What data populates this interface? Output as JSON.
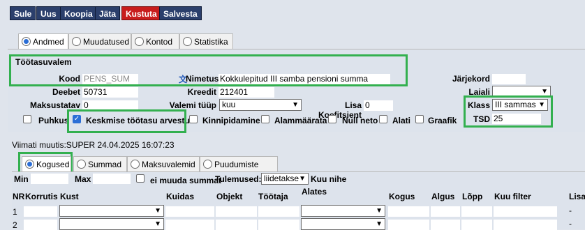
{
  "toolbar": {
    "buttons": [
      "Sule",
      "Uus",
      "Koopia",
      "Jäta",
      "Kustuta",
      "Salvesta"
    ]
  },
  "tabs": [
    "Andmed",
    "Muudatused",
    "Kontod",
    "Statistika"
  ],
  "section_title": "Töötasuvalem",
  "form": {
    "kood_label": "Kood",
    "kood_value": "PENS_SUM",
    "nimetus_label": "Nimetus",
    "nimetus_value": "Kokkulepitud III samba pensioni summa",
    "jarjekord_label": "Järjekord",
    "deebet_label": "Deebet",
    "deebet_value": "50731",
    "kreedit_label": "Kreedit",
    "kreedit_value": "212401",
    "laiali_label": "Laiali",
    "maksustatav_label": "Maksustatav",
    "maksustatav_value": "0",
    "valemi_tyyp_label": "Valemi tüüp",
    "valemi_tyyp_value": "kuu",
    "lisa_koef_label": "Lisa Koefitsient",
    "lisa_koef_value": "0",
    "klass_label": "Klass",
    "klass_value": "III sammas",
    "tsd_label": "TSD",
    "tsd_value": "25"
  },
  "checkboxes": [
    {
      "label": "Puhkus",
      "checked": false
    },
    {
      "label": "Keskmise töötasu arvestus",
      "checked": true
    },
    {
      "label": "Kinnipidamine",
      "checked": false
    },
    {
      "label": "Alammäärata",
      "checked": false
    },
    {
      "label": "Null neto",
      "checked": false
    },
    {
      "label": "Alati",
      "checked": false
    },
    {
      "label": "Graafik",
      "checked": false
    }
  ],
  "last_modified": "Viimati muutis:SUPER 24.04.2025 16:07:23",
  "subtabs": [
    "Kogused",
    "Summad",
    "Maksuvalemid",
    "Puudumiste liigid"
  ],
  "filters": {
    "min_label": "Min",
    "max_label": "Max",
    "ei_muuda_label": "ei muuda summat",
    "tulemused_label": "Tulemused:",
    "tulemused_value": "liidetakse",
    "kuu_nihe_label": "Kuu nihe"
  },
  "table": {
    "headers": [
      "NR",
      "Korrutis",
      "Kust",
      "Kuidas",
      "Objekt",
      "Töötaja",
      "Alates",
      "Kogus",
      "Algus",
      "Lõpp",
      "Kuu filter",
      "Lisad"
    ],
    "rows": [
      {
        "nr": "1",
        "lisad": "-"
      },
      {
        "nr": "2",
        "lisad": "-"
      }
    ]
  },
  "colors": {
    "button_bg": "#2b3f6c",
    "delete_bg": "#c81d1d",
    "highlight": "#33b04f",
    "page_bg": "#dfe4ec"
  }
}
